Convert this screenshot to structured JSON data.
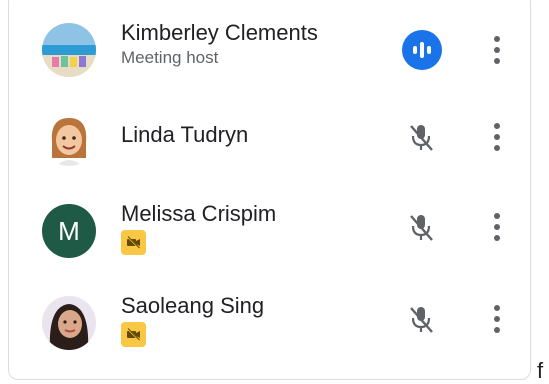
{
  "participants": [
    {
      "name": "Kimberley Clements",
      "role": "Meeting host",
      "mic": "speaking",
      "avatar": "beach-chairs-photo",
      "badge": ""
    },
    {
      "name": "Linda Tudryn",
      "role": "",
      "mic": "muted",
      "avatar": "emoji-avatar",
      "badge": ""
    },
    {
      "name": "Melissa Crispim",
      "initial": "M",
      "mic": "muted",
      "avatar": "initial",
      "badge": "video-off-icon"
    },
    {
      "name": "Saoleang Sing",
      "mic": "muted",
      "avatar": "person-photo",
      "badge": "video-off-icon"
    }
  ],
  "colors": {
    "accent": "#1a73e8",
    "initial_avatar": "#1e5a45",
    "badge": "#f9c744",
    "muted_icon": "#5f6368"
  },
  "corner_char": "f"
}
